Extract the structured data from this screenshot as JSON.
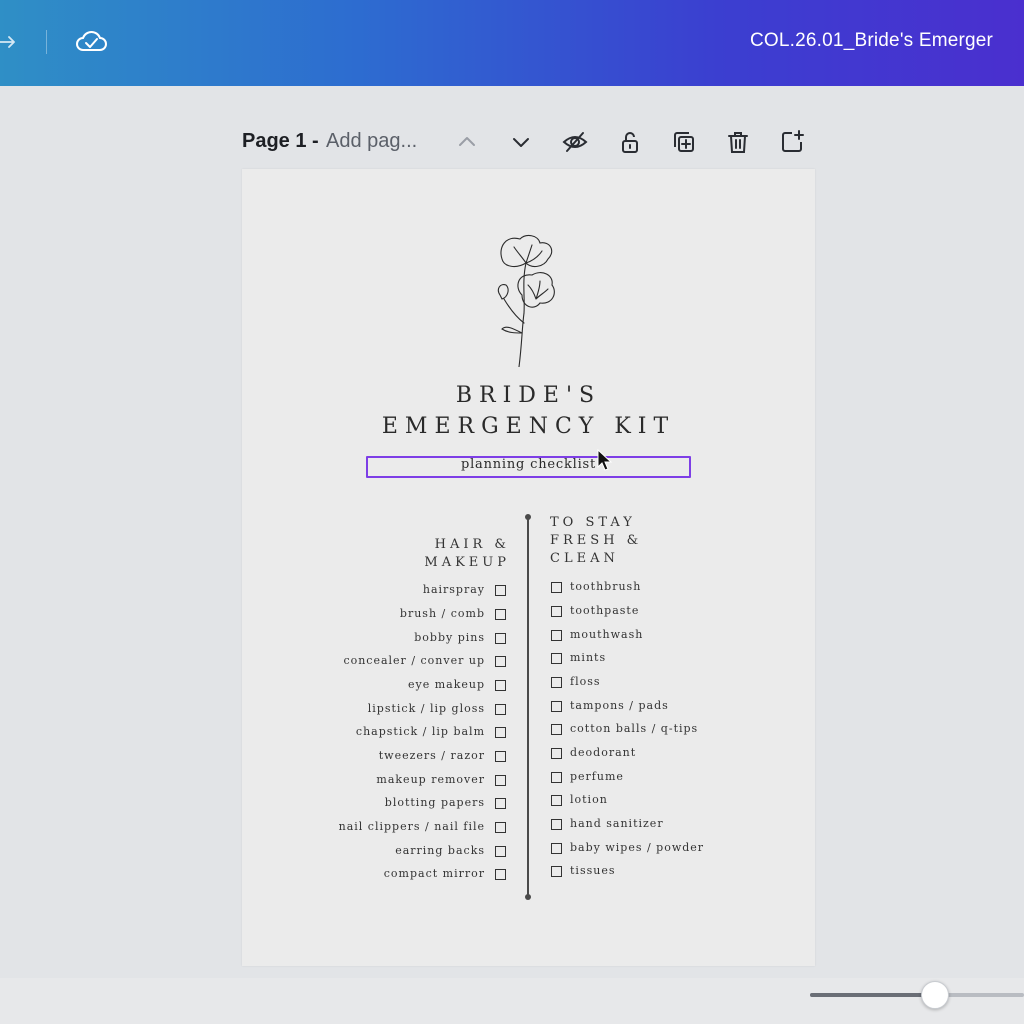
{
  "app": {
    "document_title": "COL.26.01_Bride's Emerger"
  },
  "icons": {
    "redo": "redo-icon",
    "cloud": "cloud-saved-icon"
  },
  "page_toolbar": {
    "page_label": "Page 1 -",
    "add_title_placeholder": "Add pag...",
    "buttons": [
      "chevron-up-icon",
      "chevron-down-icon",
      "hide-eye-icon",
      "lock-icon",
      "duplicate-page-icon",
      "trash-icon",
      "add-page-icon"
    ]
  },
  "document": {
    "title_line1": "BRIDE'S",
    "title_line2": "EMERGENCY KIT",
    "subtitle": "planning checklist",
    "selection_color": "#7d3ee6",
    "left_column": {
      "heading_line1": "HAIR &",
      "heading_line2": "MAKEUP",
      "items": [
        "hairspray",
        "brush / comb",
        "bobby pins",
        "concealer / conver up",
        "eye makeup",
        "lipstick / lip gloss",
        "chapstick / lip balm",
        "tweezers / razor",
        "makeup remover",
        "blotting papers",
        "nail clippers / nail file",
        "earring backs",
        "compact mirror"
      ]
    },
    "right_column": {
      "heading_line1": "TO STAY",
      "heading_line2": "FRESH &",
      "heading_line3": "CLEAN",
      "items": [
        "toothbrush",
        "toothpaste",
        "mouthwash",
        "mints",
        "floss",
        "tampons / pads",
        "cotton balls / q-tips",
        "deodorant",
        "perfume",
        "lotion",
        "hand sanitizer",
        "baby wipes / powder",
        "tissues"
      ]
    }
  },
  "zoom": {
    "slider_fraction": 0.58
  },
  "colors": {
    "topbar_start": "#2f8fc6",
    "topbar_end": "#4a2fcf",
    "canvas_bg": "#e2e4e7",
    "page_bg": "#ebebeb"
  }
}
